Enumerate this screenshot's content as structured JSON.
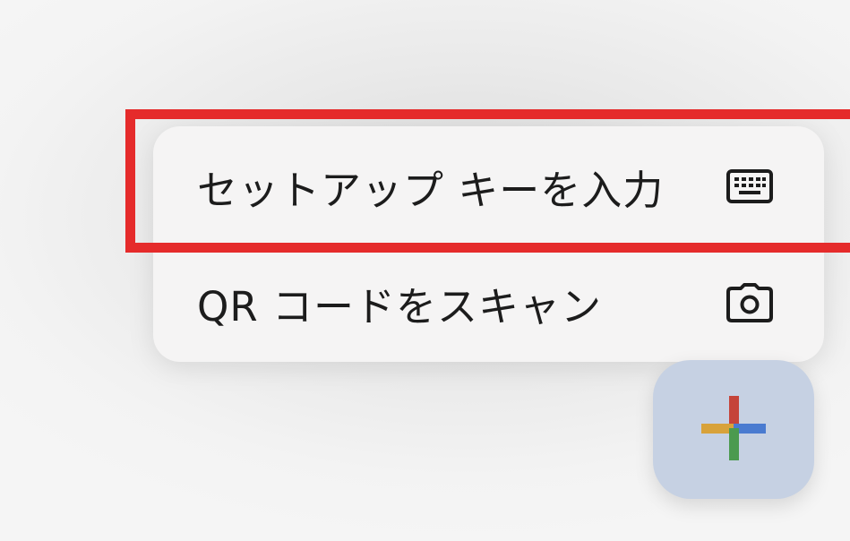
{
  "menu": {
    "items": [
      {
        "label": "セットアップ キーを入力",
        "icon": "keyboard-icon"
      },
      {
        "label": "QR コードをスキャン",
        "icon": "camera-icon"
      }
    ]
  },
  "fab": {
    "icon": "plus-icon"
  },
  "colors": {
    "highlight": "#e52b2b",
    "menu_background": "#f5f4f4",
    "fab_background": "#c6d1e3",
    "plus_red": "#c5443a",
    "plus_blue": "#4a7bd0",
    "plus_yellow": "#d8a23a",
    "plus_green": "#4b9a4f"
  }
}
